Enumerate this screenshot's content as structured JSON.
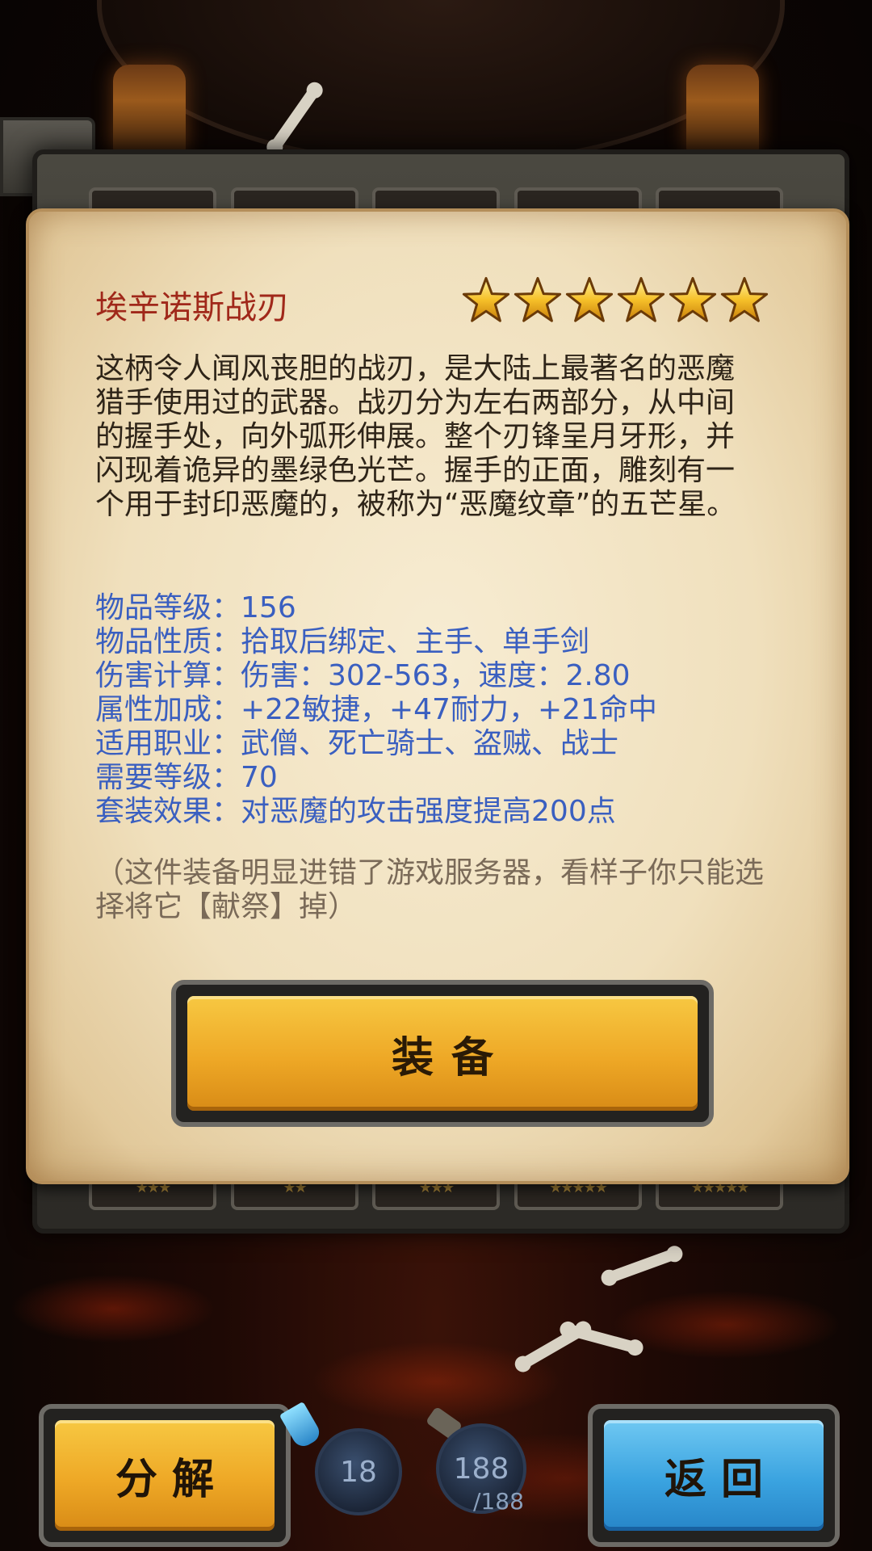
{
  "item": {
    "name": "埃辛诺斯战刃",
    "star_rating": 6,
    "star_max": 6,
    "description": "这柄令人闻风丧胆的战刃，是大陆上最著名的恶魔猎手使用过的武器。战刃分为左右两部分，从中间的握手处，向外弧形伸展。整个刃锋呈月牙形，并闪现着诡异的墨绿色光芒。握手的正面，雕刻有一个用于封印恶魔的，被称为“恶魔纹章”的五芒星。",
    "stats": [
      {
        "label": "物品等级：",
        "value": "156"
      },
      {
        "label": "物品性质：",
        "value": "拾取后绑定、主手、单手剑"
      },
      {
        "label": "伤害计算：",
        "value": "伤害：302-563，速度：2.80"
      },
      {
        "label": "属性加成：",
        "value": "+22敏捷，+47耐力，+21命中"
      },
      {
        "label": "适用职业：",
        "value": "武僧、死亡骑士、盗贼、战士"
      },
      {
        "label": "需要等级：",
        "value": "70"
      },
      {
        "label": "套装效果：",
        "value": "对恶魔的攻击强度提高200点"
      }
    ],
    "note": "（这件装备明显进错了游戏服务器，看样子你只能选择将它【献祭】掉）"
  },
  "buttons": {
    "equip": "装备",
    "decompose": "分解",
    "back": "返回"
  },
  "counters": {
    "gems": "18",
    "stamina": "188",
    "stamina_max": "/188"
  },
  "slots_bottom": [
    "★★★",
    "★★",
    "★★★",
    "★★★★★",
    "★★★★★"
  ],
  "colors": {
    "title": "#a0281a",
    "stats": "#3a5fc0",
    "note": "#7a6a58",
    "equip_button": "#eea826",
    "back_button": "#3aa3e0"
  }
}
